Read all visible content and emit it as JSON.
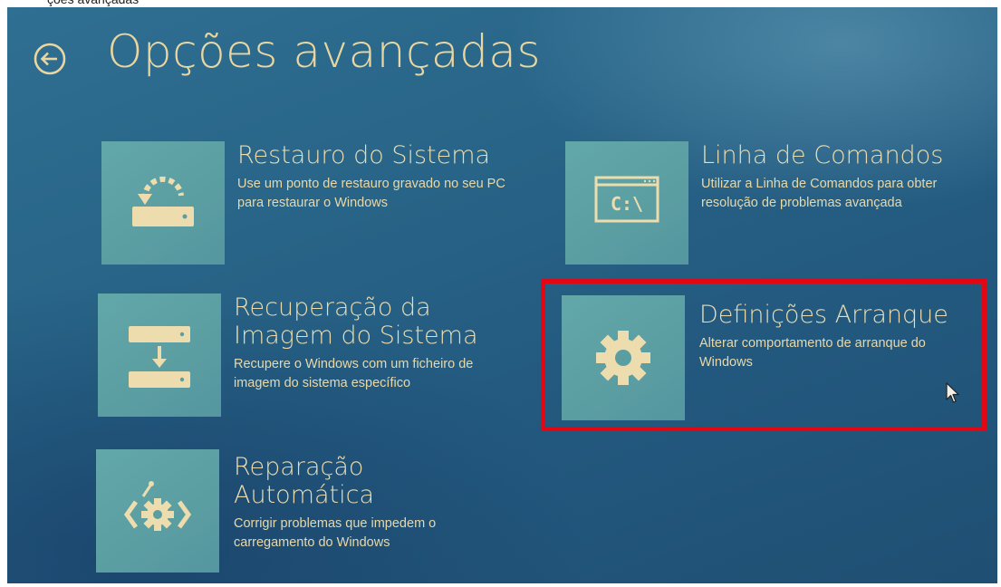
{
  "header": {
    "title": "Opções avançadas",
    "back_icon": "back-arrow-circle-icon"
  },
  "options": [
    {
      "id": "system-restore",
      "title": "Restauro do Sistema",
      "description": "Use um ponto de restauro gravado no seu PC para restaurar o Windows",
      "icon": "system-restore-icon"
    },
    {
      "id": "command-prompt",
      "title": "Linha de Comandos",
      "description": "Utilizar a Linha de Comandos para obter resolução de problemas avançada",
      "icon": "command-prompt-icon",
      "icon_text": "C:\\"
    },
    {
      "id": "system-image-recovery",
      "title": "Recuperação da Imagem do Sistema",
      "description": "Recupere o Windows com um ficheiro de imagem do sistema específico",
      "icon": "system-image-icon"
    },
    {
      "id": "startup-settings",
      "title": "Definições Arranque",
      "description": "Alterar comportamento de arranque do Windows",
      "icon": "gear-icon",
      "highlighted": true
    },
    {
      "id": "automatic-repair",
      "title": "Reparação Automática",
      "description": "Corrigir problemas que impedem o carregamento do Windows",
      "icon": "automatic-repair-icon"
    }
  ],
  "colors": {
    "background": "#286487",
    "tile": "#5b9ea2",
    "text": "#ecdcae",
    "highlight_border": "#e30613"
  }
}
